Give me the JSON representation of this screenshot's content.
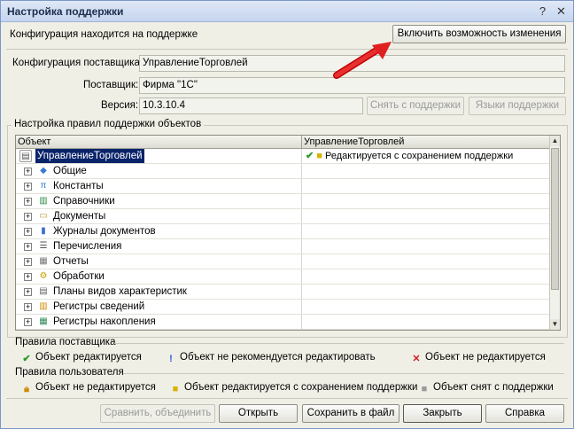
{
  "window": {
    "title": "Настройка поддержки",
    "help_label": "?",
    "close_label": "✕"
  },
  "header": {
    "status_text": "Конфигурация находится на поддержке",
    "enable_button": "Включить возможность изменения"
  },
  "vendor": {
    "config_label": "Конфигурация поставщика:",
    "config_value": "УправлениеТорговлей",
    "supplier_label": "Поставщик:",
    "supplier_value": "Фирма \"1С\"",
    "version_label": "Версия:",
    "version_value": "10.3.10.4",
    "remove_support_button": "Снять с поддержки",
    "support_languages_button": "Языки поддержки"
  },
  "rules_group": {
    "title": "Настройка правил поддержки объектов",
    "columns": [
      "Объект",
      "УправлениеТорговлей"
    ],
    "root": {
      "label": "УправлениеТорговлей",
      "rule": "Редактируется с сохранением поддержки"
    },
    "items": [
      {
        "label": "Общие",
        "icon": "common-icon"
      },
      {
        "label": "Константы",
        "icon": "constants-icon"
      },
      {
        "label": "Справочники",
        "icon": "catalogs-icon"
      },
      {
        "label": "Документы",
        "icon": "documents-icon"
      },
      {
        "label": "Журналы документов",
        "icon": "journals-icon"
      },
      {
        "label": "Перечисления",
        "icon": "enums-icon"
      },
      {
        "label": "Отчеты",
        "icon": "reports-icon"
      },
      {
        "label": "Обработки",
        "icon": "processing-icon"
      },
      {
        "label": "Планы видов характеристик",
        "icon": "charts-icon"
      },
      {
        "label": "Регистры сведений",
        "icon": "info-registers-icon"
      },
      {
        "label": "Регистры накопления",
        "icon": "accumulation-registers-icon"
      }
    ]
  },
  "legend": {
    "vendor_rules_title": "Правила поставщика",
    "vendor_rules": [
      "Объект редактируется",
      "Объект не рекомендуется редактировать",
      "Объект не редактируется"
    ],
    "user_rules_title": "Правила пользователя",
    "user_rules": [
      "Объект не редактируется",
      "Объект редактируется с сохранением поддержки",
      "Объект снят с поддержки"
    ]
  },
  "footer": {
    "compare_button": "Сравнить, объединить",
    "open_button": "Открыть",
    "save_button": "Сохранить в файл",
    "close_button": "Закрыть",
    "help_button": "Справка"
  },
  "colors": {
    "accent": "#e02020",
    "selection": "#0a246a"
  }
}
